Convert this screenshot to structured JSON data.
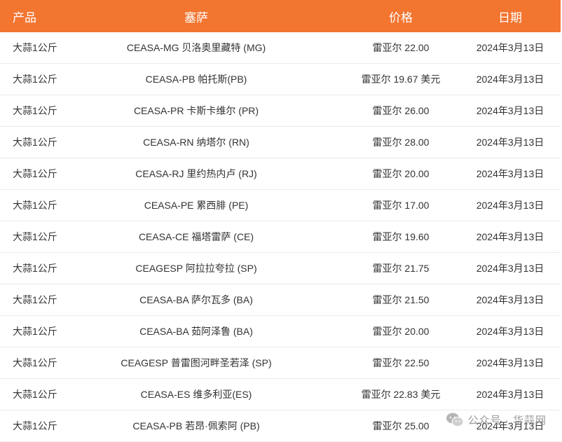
{
  "header": {
    "product": "产品",
    "market": "塞萨",
    "price": "价格",
    "date": "日期"
  },
  "rows": [
    {
      "product": "大蒜1公斤",
      "market": "CEASA-MG 贝洛奥里藏特 (MG)",
      "price": "雷亚尔 22.00",
      "date": "2024年3月13日"
    },
    {
      "product": "大蒜1公斤",
      "market": "CEASA-PB 帕托斯(PB)",
      "price": "雷亚尔 19.67 美元",
      "date": "2024年3月13日"
    },
    {
      "product": "大蒜1公斤",
      "market": "CEASA-PR 卡斯卡维尔 (PR)",
      "price": "雷亚尔 26.00",
      "date": "2024年3月13日"
    },
    {
      "product": "大蒜1公斤",
      "market": "CEASA-RN 纳塔尔 (RN)",
      "price": "雷亚尔 28.00",
      "date": "2024年3月13日"
    },
    {
      "product": "大蒜1公斤",
      "market": "CEASA-RJ 里约热内卢 (RJ)",
      "price": "雷亚尔 20.00",
      "date": "2024年3月13日"
    },
    {
      "product": "大蒜1公斤",
      "market": "CEASA-PE 累西腓 (PE)",
      "price": "雷亚尔 17.00",
      "date": "2024年3月13日"
    },
    {
      "product": "大蒜1公斤",
      "market": "CEASA-CE 福塔雷萨 (CE)",
      "price": "雷亚尔 19.60",
      "date": "2024年3月13日"
    },
    {
      "product": "大蒜1公斤",
      "market": "CEAGESP 阿拉拉夸拉 (SP)",
      "price": "雷亚尔 21.75",
      "date": "2024年3月13日"
    },
    {
      "product": "大蒜1公斤",
      "market": "CEASA-BA 萨尔瓦多 (BA)",
      "price": "雷亚尔 21.50",
      "date": "2024年3月13日"
    },
    {
      "product": "大蒜1公斤",
      "market": "CEASA-BA 茹阿泽鲁 (BA)",
      "price": "雷亚尔 20.00",
      "date": "2024年3月13日"
    },
    {
      "product": "大蒜1公斤",
      "market": "CEAGESP 普雷图河畔圣若泽 (SP)",
      "price": "雷亚尔 22.50",
      "date": "2024年3月13日"
    },
    {
      "product": "大蒜1公斤",
      "market": "CEASA-ES 维多利亚(ES)",
      "price": "雷亚尔 22.83 美元",
      "date": "2024年3月13日"
    },
    {
      "product": "大蒜1公斤",
      "market": "CEASA-PB 若昂·佩索阿 (PB)",
      "price": "雷亚尔 25.00",
      "date": "2024年3月13日"
    }
  ],
  "watermark": {
    "icon": "wechat-icon",
    "text": "公众号 · 华蒜网"
  },
  "colors": {
    "header_bg": "#f27530",
    "header_text": "#ffffff",
    "row_border": "#ebebeb",
    "text": "#333333"
  }
}
